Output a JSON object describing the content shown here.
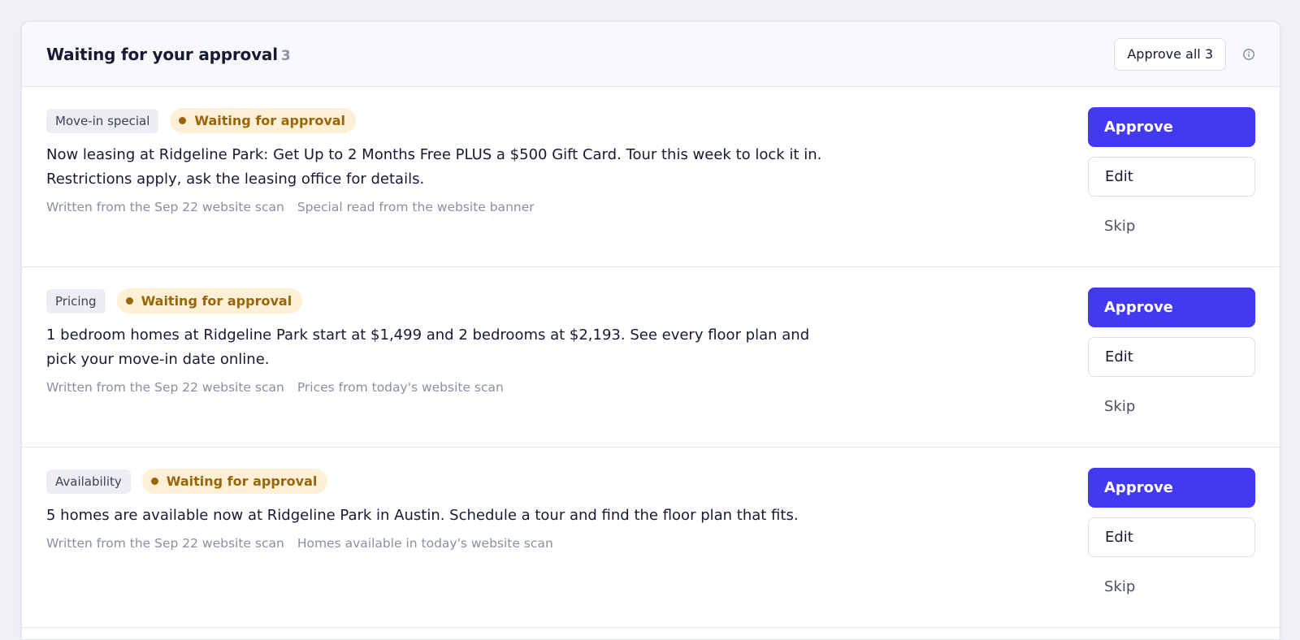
{
  "header": {
    "title": "Waiting for your approval",
    "count": "3",
    "approve_all_label": "Approve all 3"
  },
  "items": [
    {
      "category": "Move-in special",
      "status": "Waiting for approval",
      "message": "Now leasing at Ridgeline Park: Get Up to 2 Months Free PLUS a $500 Gift Card. Tour this week to lock it in. Restrictions apply, ask the leasing office for details.",
      "source": "Written from the Sep 22 website scan",
      "note": "Special read from the website banner",
      "approve_label": "Approve",
      "edit_label": "Edit",
      "skip_label": "Skip"
    },
    {
      "category": "Pricing",
      "status": "Waiting for approval",
      "message": "1 bedroom homes at Ridgeline Park start at $1,499 and 2 bedrooms at $2,193. See every floor plan and pick your move-in date online.",
      "source": "Written from the Sep 22 website scan",
      "note": "Prices from today's website scan",
      "approve_label": "Approve",
      "edit_label": "Edit",
      "skip_label": "Skip"
    },
    {
      "category": "Availability",
      "status": "Waiting for approval",
      "message": "5 homes are available now at Ridgeline Park in Austin. Schedule a tour and find the floor plan that fits.",
      "source": "Written from the Sep 22 website scan",
      "note": "Homes available in today's website scan",
      "approve_label": "Approve",
      "edit_label": "Edit",
      "skip_label": "Skip"
    }
  ],
  "colors": {
    "accent": "#4339f2",
    "status_bg": "#fdf0d6",
    "status_text": "#9a6508"
  },
  "icons": {
    "header_info": "info-icon"
  }
}
